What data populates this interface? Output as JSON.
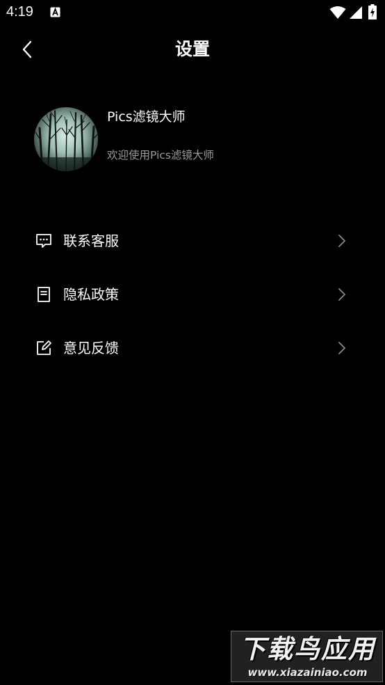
{
  "status_bar": {
    "time": "4:19"
  },
  "header": {
    "title": "设置",
    "back_icon": "chevron-left-icon"
  },
  "profile": {
    "name": "Pics滤镜大师",
    "subtitle": "欢迎使用Pics滤镜大师"
  },
  "menu": {
    "items": [
      {
        "label": "联系客服",
        "icon": "chat-bubble-icon"
      },
      {
        "label": "隐私政策",
        "icon": "document-icon"
      },
      {
        "label": "意见反馈",
        "icon": "edit-icon"
      }
    ]
  },
  "watermark": {
    "title": "下载鸟应用",
    "url": "www.xiazainiao.com"
  },
  "colors": {
    "background": "#000000",
    "text_primary": "#ffffff",
    "text_secondary": "#9a9a9a",
    "chevron": "#8a8a8a"
  }
}
